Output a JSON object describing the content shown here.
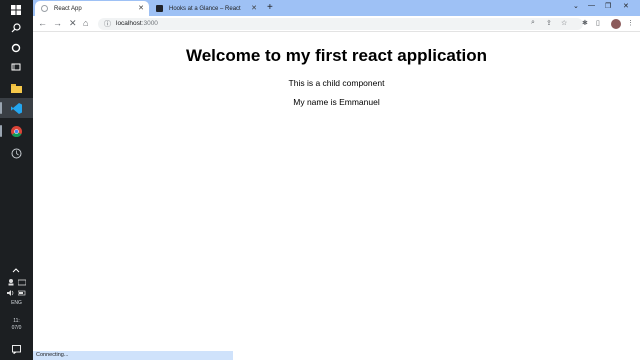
{
  "browser": {
    "tabs": [
      {
        "title": "React App",
        "active": true
      },
      {
        "title": "Hooks at a Glance – React",
        "active": false
      }
    ],
    "address": {
      "host": "localhost",
      "port": ":3000"
    },
    "status_text": "Connecting..."
  },
  "page": {
    "heading": "Welcome to my first react application",
    "child_text": "This is a child component",
    "name_text": "My name is Emmanuel"
  },
  "taskbar": {
    "language": "ENG",
    "clock_time": "11:",
    "clock_date": "07/0"
  },
  "colors": {
    "tabstrip": "#9ec1f5",
    "taskbar": "#1c1f22",
    "status": "#cfe2fb"
  }
}
